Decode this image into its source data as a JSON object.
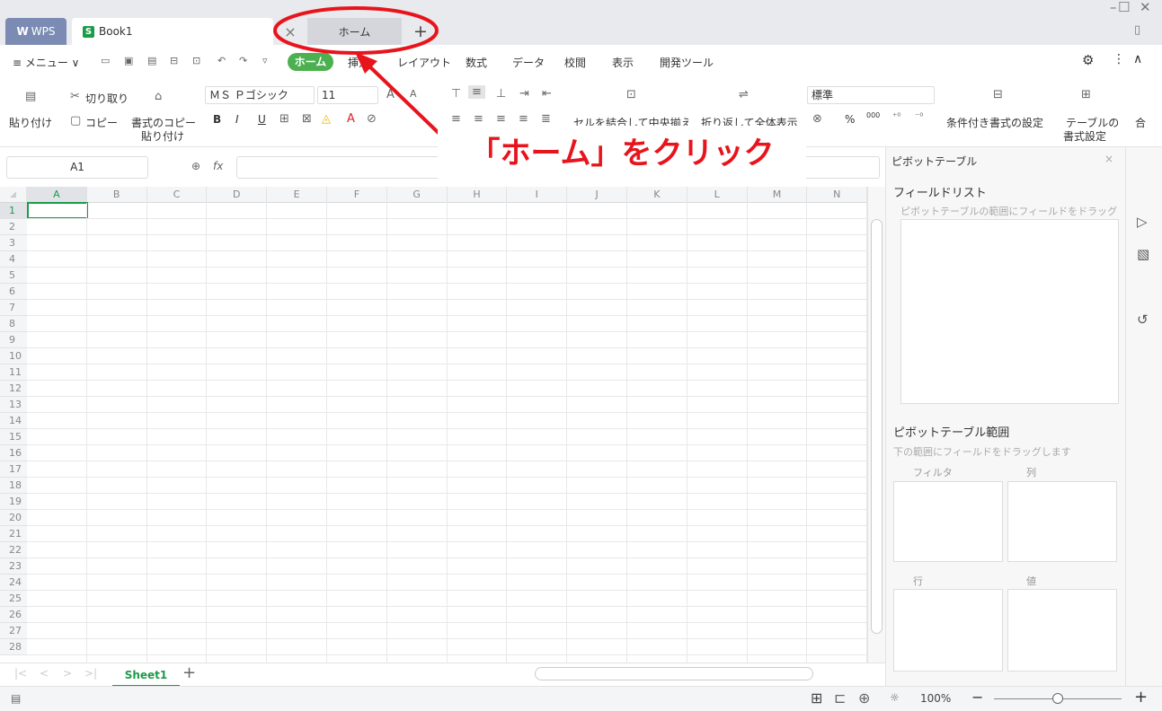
{
  "tabs": {
    "wps": "WPS",
    "book1": "Book1",
    "home": "ホーム",
    "close": "×",
    "add": "+"
  },
  "window": {
    "minimize": "–",
    "maximize": "☐",
    "close": "✕"
  },
  "menu": {
    "menu_label": "≡ メニュー ∨",
    "items": [
      "ホーム",
      "挿入",
      "レイアウト",
      "数式",
      "データ",
      "校閲",
      "表示",
      "開発ツール"
    ]
  },
  "ribbon": {
    "paste": "貼り付け",
    "cut": "切り取り",
    "copy": "コピー",
    "format_painter": "書式のコピー",
    "format_painter2": "貼り付け",
    "font_name": "ＭＳ Ｐゴシック",
    "font_size": "11",
    "bold": "B",
    "italic": "I",
    "underline": "U",
    "merge": "セルを結合して中央揃え",
    "wrap": "折り返して全体表示",
    "number_format": "標準",
    "percent": "%",
    "thousands": "000",
    "conditional": "条件付き書式の設定",
    "table_format1": "テーブルの",
    "table_format2": "書式設定",
    "total": "合"
  },
  "formula": {
    "namebox": "A1",
    "fx": "fx"
  },
  "columns": [
    "A",
    "B",
    "C",
    "D",
    "E",
    "F",
    "G",
    "H",
    "I",
    "J",
    "K",
    "L",
    "M",
    "N"
  ],
  "rows": [
    "1",
    "2",
    "3",
    "4",
    "5",
    "6",
    "7",
    "8",
    "9",
    "10",
    "11",
    "12",
    "13",
    "14",
    "15",
    "16",
    "17",
    "18",
    "19",
    "20",
    "21",
    "22",
    "23",
    "24",
    "25",
    "26",
    "27",
    "28"
  ],
  "sheet": {
    "name": "Sheet1",
    "add": "+"
  },
  "status": {
    "zoom": "100%",
    "zoom_minus": "−",
    "zoom_plus": "+"
  },
  "pivot": {
    "title": "ピボットテーブル",
    "field_list": "フィールドリスト",
    "field_hint": "ピボットテーブルの範囲にフィールドをドラッグします",
    "range": "ピボットテーブル範囲",
    "range_hint": "下の範囲にフィールドをドラッグします",
    "filter": "フィルタ",
    "column": "列",
    "row": "行",
    "value": "値"
  },
  "annotation": {
    "text": "「ホーム」をクリック",
    "color": "#e8141c"
  }
}
